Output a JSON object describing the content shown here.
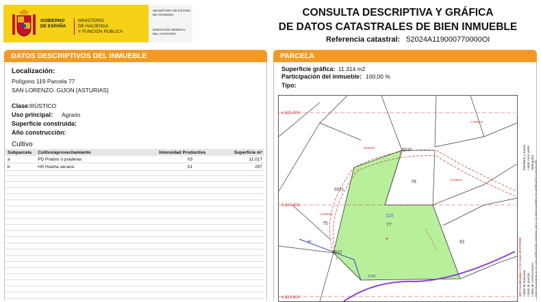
{
  "header": {
    "gobierno": [
      "GOBIERNO",
      "DE ESPAÑA"
    ],
    "ministerio": [
      "MINISTERIO",
      "DE HACIENDA",
      "Y FUNCIÓN PÚBLICA"
    ],
    "secretaria": [
      "SECRETARÍA DE ESTADO",
      "DE HACIENDA"
    ],
    "direccion": [
      "DIRECCIÓN GENERAL",
      "DEL CATASTRO"
    ],
    "title_line1": "CONSULTA DESCRIPTIVA Y GRÁFICA",
    "title_line2": "DE DATOS CATASTRALES DE BIEN INMUEBLE",
    "ref_label": "Referencia catastral:",
    "ref_value": "52024A119000770000OI"
  },
  "left": {
    "section_title_1": "DATOS DESCRIPTIVOS DEL",
    "section_title_2": "INMUEBLE",
    "localizacion_label": "Localización:",
    "localizacion_line1": "Polígono 119 Parcela 77",
    "localizacion_line2": "SAN LORENZO. GIJON [ASTURIAS]",
    "clase_label": "Clase:",
    "clase_value": "RÚSTICO",
    "uso_label": "Uso principal:",
    "uso_value": "Agrario",
    "superficie_label": "Superficie construida:",
    "anio_label": "Año construcción:",
    "cultivo_title": "Cultivo",
    "table_headers": [
      "Subparcela",
      "Cultivo/aprovechamiento",
      "Intensidad Productiva",
      "Superficie m²"
    ],
    "table_rows": [
      [
        "a",
        "PD Prados o praderas",
        "03",
        "11.017"
      ],
      [
        "b",
        "HS Huerta secano",
        "01",
        "297"
      ]
    ]
  },
  "right": {
    "section_title": "PARCELA",
    "superficie_label": "Superficie gráfica:",
    "superficie_value": "11.314 m2",
    "participacion_label": "Participación del inmueble:",
    "participacion_value": "100,00 %",
    "tipo_label": "Tipo:"
  },
  "map": {
    "y_labels": [
      "4.825.000",
      "4.824.900",
      "4.824.800"
    ],
    "parcel_labels": [
      "78",
      "119",
      "77",
      "75",
      "81",
      "9021",
      "9022",
      "9020",
      "44",
      "2749"
    ],
    "road_labels": [
      "MONTE",
      "CAMINO",
      "CAMINO",
      "CAMINO"
    ],
    "legend": [
      "Límite de manzana",
      "Límite de parcela",
      "Límite de construcciones",
      "Mobiliario y aceras",
      "Límite zona verde",
      "Hidrografía"
    ],
    "coords_note": "605 Coordenadas U.T.M. Huso 30 ETRS89",
    "footer_note": "Este documento no es una certificación catastral, pero sus datos pueden ser verificados a través del"
  },
  "colors": {
    "orange": "#f39a25",
    "parcel_green": "#b7ef9b",
    "yellow": "#f7d117",
    "purple": "#8a3fd6"
  }
}
